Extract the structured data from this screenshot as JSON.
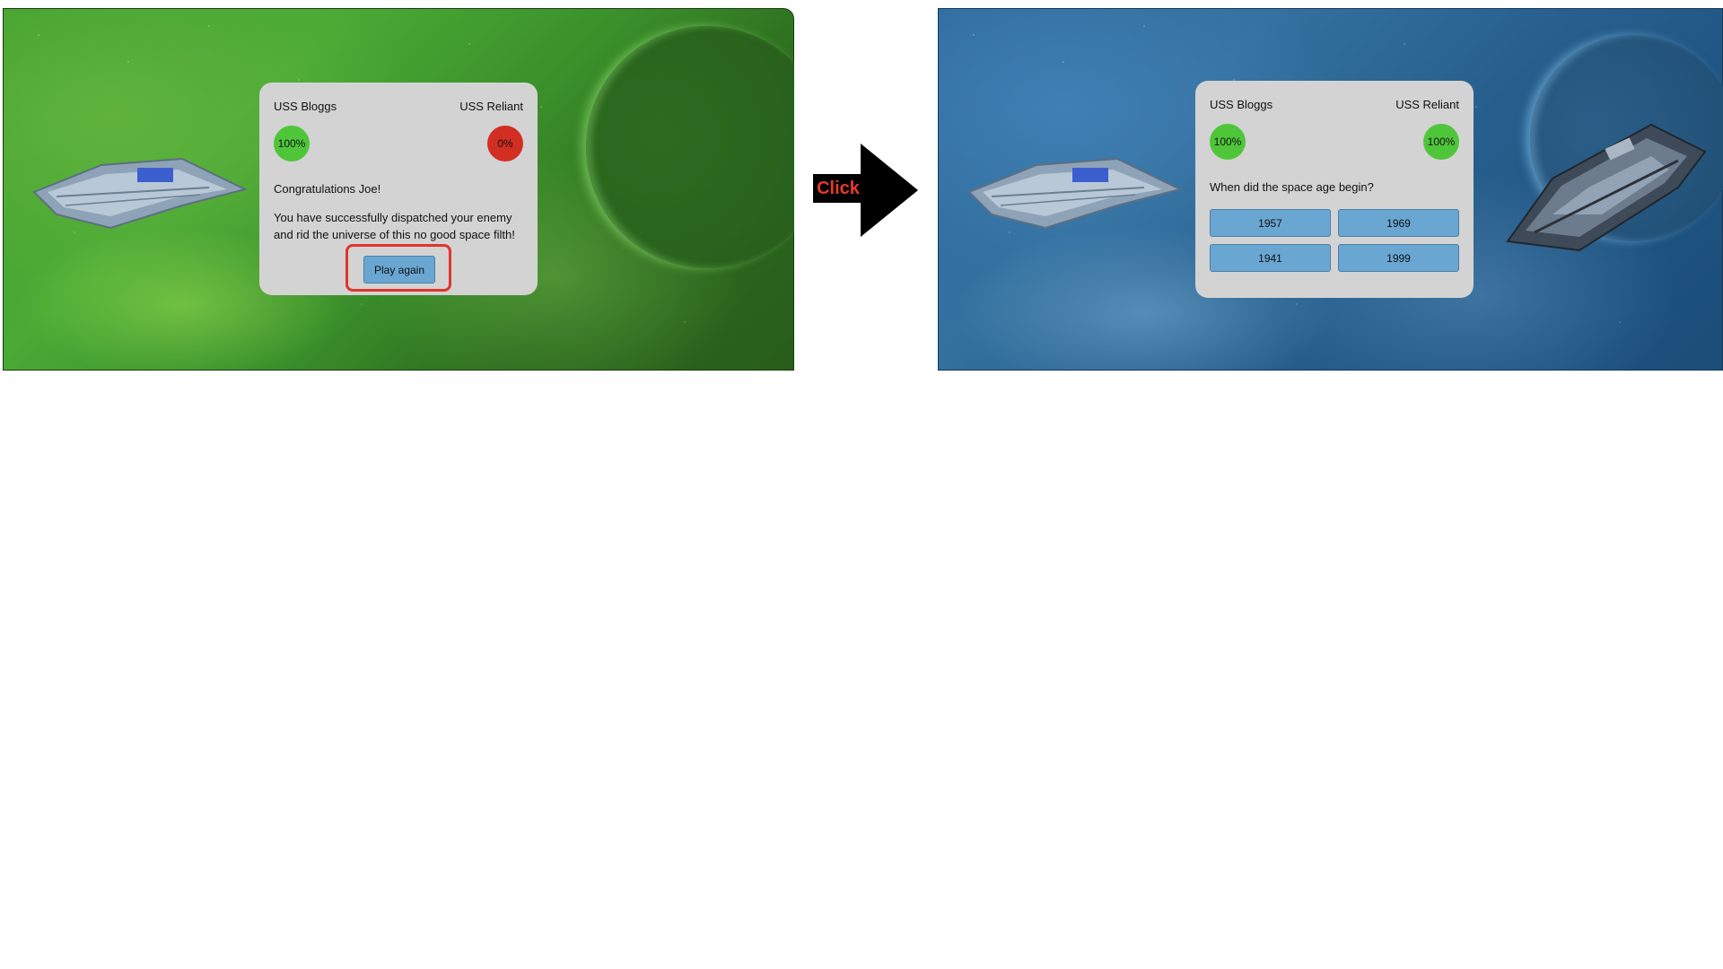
{
  "colors": {
    "health_full": "#4fc63a",
    "health_empty": "#d32e22",
    "button_bg": "#6aa6d2",
    "highlight": "#e0352b",
    "arrow_text": "#e6392f"
  },
  "before": {
    "player_name": "USS Bloggs",
    "enemy_name": "USS Reliant",
    "player_health": "100%",
    "enemy_health": "0%",
    "message_title": "Congratulations Joe!",
    "message_body": "You have successfully dispatched your enemy and rid the universe of this no good space filth!",
    "play_again_label": "Play again"
  },
  "transition": {
    "label": "Click"
  },
  "after": {
    "player_name": "USS Bloggs",
    "enemy_name": "USS Reliant",
    "player_health": "100%",
    "enemy_health": "100%",
    "question": "When did the space age begin?",
    "answers": [
      "1957",
      "1969",
      "1941",
      "1999"
    ]
  }
}
